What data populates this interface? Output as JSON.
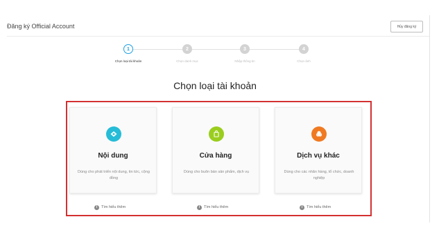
{
  "header": {
    "title": "Đăng ký Official Account",
    "cancel_label": "Hủy đăng ký"
  },
  "stepper": {
    "steps": [
      {
        "number": "1",
        "label": "Chọn loại tài khoản",
        "active": true
      },
      {
        "number": "2",
        "label": "Chọn danh mục",
        "active": false
      },
      {
        "number": "3",
        "label": "Nhập thông tin",
        "active": false
      },
      {
        "number": "4",
        "label": "Chọn ảnh",
        "active": false
      }
    ]
  },
  "main": {
    "title": "Chọn loại tài khoản",
    "cards": [
      {
        "title": "Nội dung",
        "description": "Dùng cho phát triển nội dung, tin tức, cộng đồng",
        "learn_more": "Tìm hiểu thêm",
        "icon": "content-icon",
        "icon_color": "#26bcd7"
      },
      {
        "title": "Cửa hàng",
        "description": "Dùng cho buôn bán sản phẩm, dịch vụ",
        "learn_more": "Tìm hiểu thêm",
        "icon": "shop-icon",
        "icon_color": "#9acd1e"
      },
      {
        "title": "Dịch vụ khác",
        "description": "Dùng cho các nhãn hàng, tổ chức, doanh nghiệp",
        "learn_more": "Tìm hiểu thêm",
        "icon": "service-icon",
        "icon_color": "#f07a22"
      }
    ]
  },
  "colors": {
    "accent": "#1a9fe0",
    "highlight": "#d32f2f"
  }
}
